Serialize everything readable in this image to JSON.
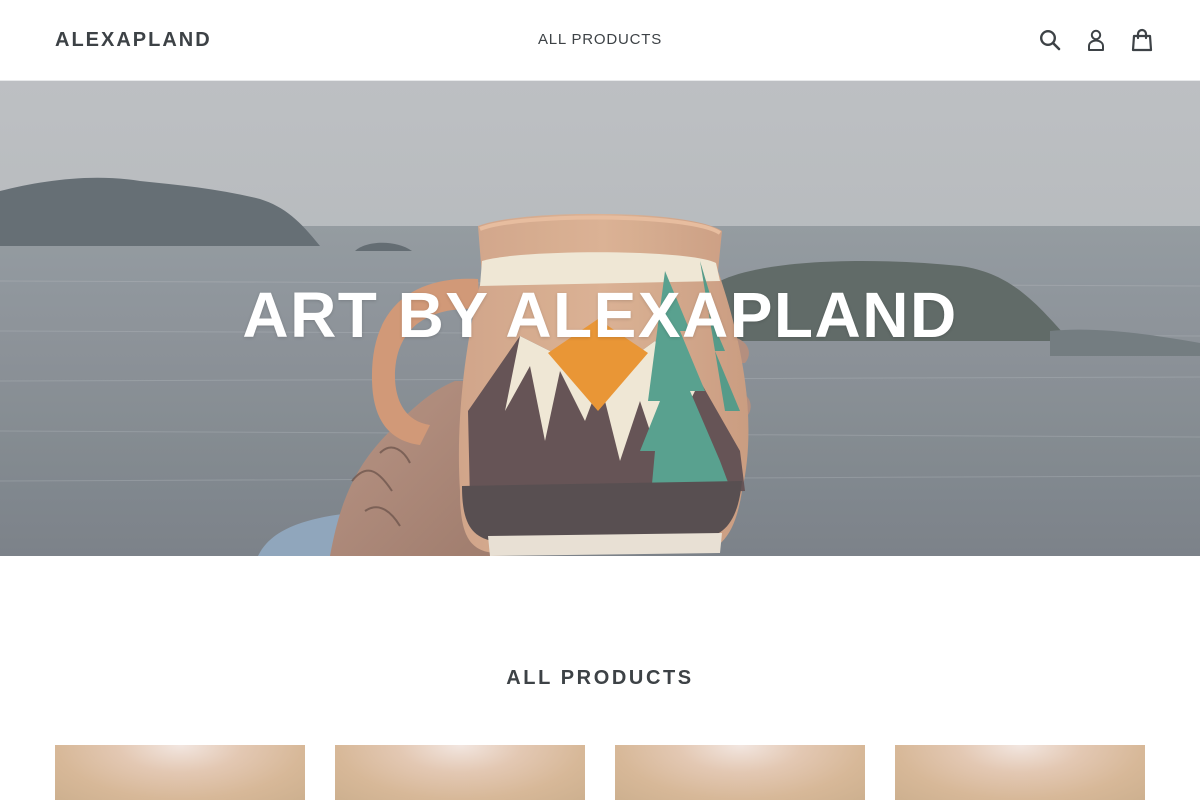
{
  "header": {
    "logo": "ALEXAPLAND",
    "nav": [
      {
        "label": "ALL PRODUCTS"
      }
    ],
    "icons": {
      "search": "search-icon",
      "account": "user-icon",
      "cart": "cart-icon"
    }
  },
  "hero": {
    "title": "ART BY ALEXAPLAND"
  },
  "collection": {
    "title": "ALL PRODUCTS",
    "products": [
      {
        "image": "product-image"
      },
      {
        "image": "product-image"
      },
      {
        "image": "product-image"
      },
      {
        "image": "product-image"
      }
    ]
  },
  "colors": {
    "text": "#3d4246",
    "border": "#e8e9eb",
    "background": "#ffffff",
    "hero_text": "#ffffff"
  }
}
